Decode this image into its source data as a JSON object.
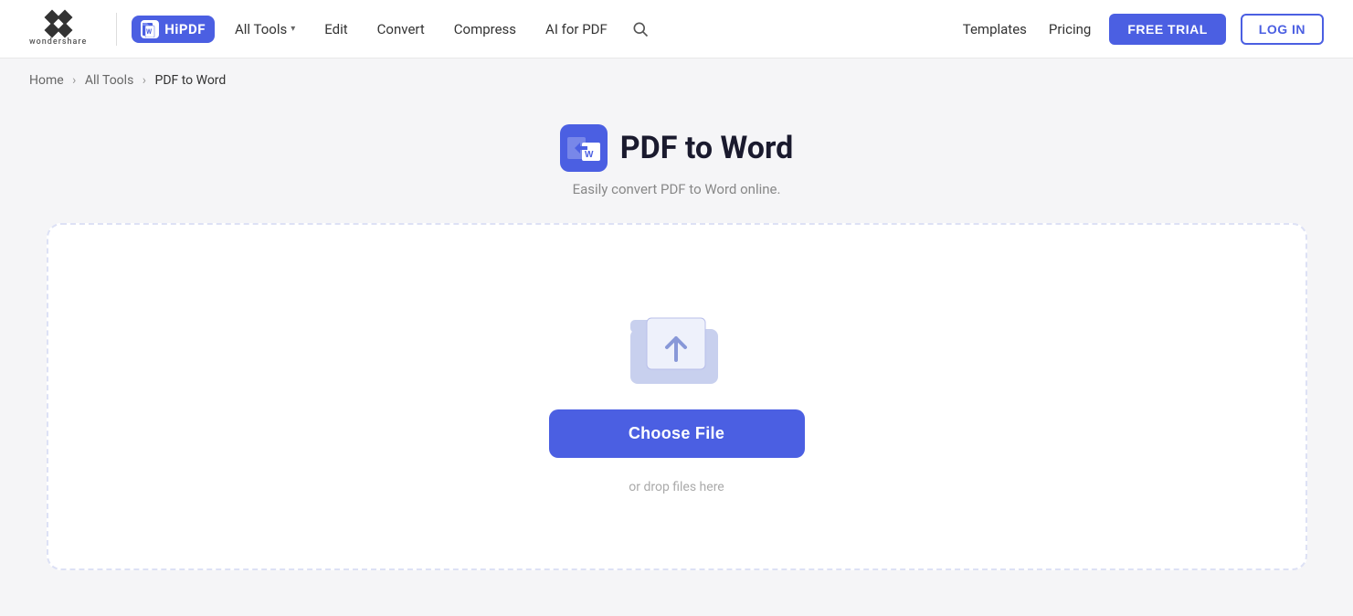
{
  "brand": {
    "ws_label": "wondershare",
    "hipdf_label": "HiPDF"
  },
  "navbar": {
    "all_tools_label": "All Tools",
    "edit_label": "Edit",
    "convert_label": "Convert",
    "compress_label": "Compress",
    "ai_for_pdf_label": "AI for PDF",
    "templates_label": "Templates",
    "pricing_label": "Pricing",
    "free_trial_label": "FREE TRIAL",
    "login_label": "LOG IN"
  },
  "breadcrumb": {
    "home": "Home",
    "all_tools": "All Tools",
    "current": "PDF to Word"
  },
  "hero": {
    "title": "PDF to Word",
    "subtitle": "Easily convert PDF to Word online."
  },
  "upload": {
    "choose_file_label": "Choose File",
    "drop_text": "or drop files here"
  }
}
